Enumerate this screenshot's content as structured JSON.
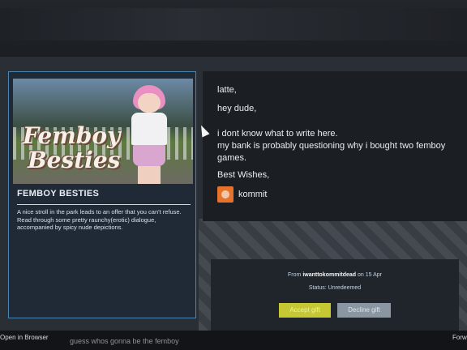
{
  "game": {
    "capsule_logo_line1": "Femboy",
    "capsule_logo_line2": "Besties",
    "title": "FEMBOY BESTIES",
    "description": "A nice stroll in the park leads to an offer that you can't refuse. Read through some pretty raunchy(erotic) dialogue, accompanied by spicy nude depictions."
  },
  "message": {
    "lines": [
      "latte,",
      "hey dude,",
      "i dont know what to write here.",
      "my bank is probably questioning why i bought two femboy games.",
      "Best Wishes,"
    ],
    "sender": "kommit"
  },
  "gift": {
    "from_label": "From",
    "from_user": "iwanttokommitdead",
    "date": "on 15 Apr",
    "status_label": "Status:",
    "status_value": "Unredeemed",
    "accept_label": "Accept gift",
    "decline_label": "Decline gift",
    "accept_color": "#c5c832",
    "decline_color": "#8a96a2"
  },
  "bottom": {
    "open_browser": "Open in Browser",
    "chat_preview": "guess whos gonna be the femboy",
    "forward": "Forw"
  }
}
